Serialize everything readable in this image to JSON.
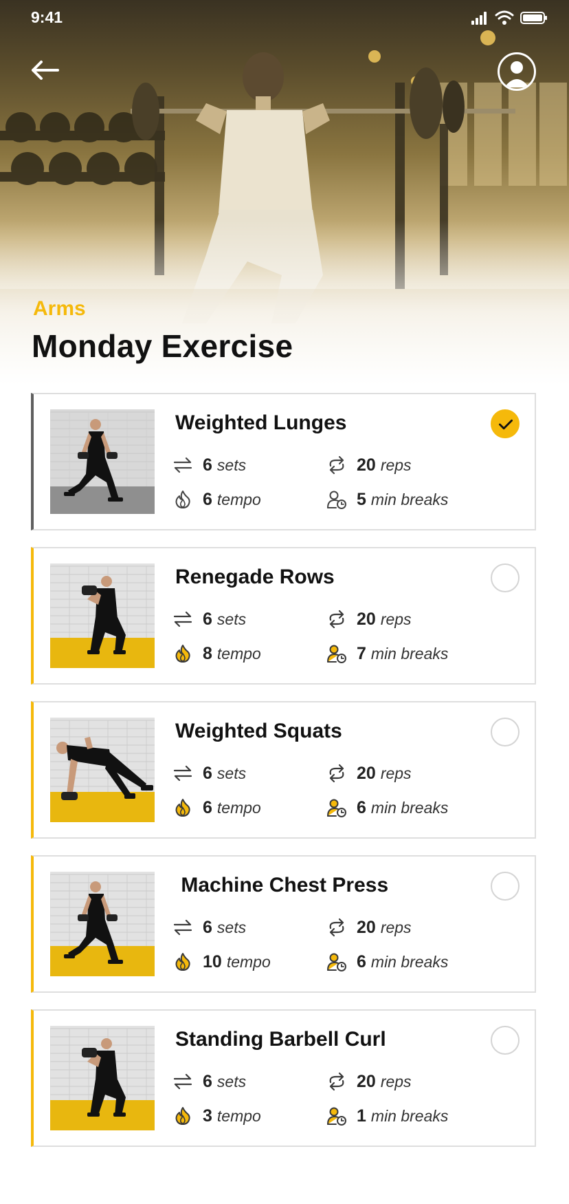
{
  "status_bar": {
    "time": "9:41"
  },
  "header": {
    "category": "Arms",
    "title": "Monday Exercise",
    "back_icon": "arrow-left-icon",
    "profile_icon": "avatar-icon"
  },
  "colors": {
    "accent": "#f5b90b",
    "done_bar": "#5f5f5f",
    "border": "#dedede"
  },
  "exercises": [
    {
      "name": "Weighted Lunges",
      "sets": "6",
      "sets_unit": "sets",
      "reps": "20",
      "reps_unit": "reps",
      "tempo": "6",
      "tempo_unit": "tempo",
      "breaks": "5",
      "breaks_unit": "min breaks",
      "completed": true,
      "photo": "lunge"
    },
    {
      "name": "Renegade Rows",
      "sets": "6",
      "sets_unit": "sets",
      "reps": "20",
      "reps_unit": "reps",
      "tempo": "8",
      "tempo_unit": "tempo",
      "breaks": "7",
      "breaks_unit": "min breaks",
      "completed": false,
      "photo": "squat"
    },
    {
      "name": "Weighted Squats",
      "sets": "6",
      "sets_unit": "sets",
      "reps": "20",
      "reps_unit": "reps",
      "tempo": "6",
      "tempo_unit": "tempo",
      "breaks": "6",
      "breaks_unit": "min breaks",
      "completed": false,
      "photo": "row"
    },
    {
      "name": " Machine Chest Press",
      "sets": "6",
      "sets_unit": "sets",
      "reps": "20",
      "reps_unit": "reps",
      "tempo": "10",
      "tempo_unit": "tempo",
      "breaks": "6",
      "breaks_unit": "min breaks",
      "completed": false,
      "photo": "lunge"
    },
    {
      "name": "Standing Barbell Curl",
      "sets": "6",
      "sets_unit": "sets",
      "reps": "20",
      "reps_unit": "reps",
      "tempo": "3",
      "tempo_unit": "tempo",
      "breaks": "1",
      "breaks_unit": "min breaks",
      "completed": false,
      "photo": "squat"
    }
  ],
  "stat_icons": {
    "sets": "transfer-arrows-icon",
    "reps": "repeat-icon",
    "tempo": "flame-icon",
    "breaks": "person-clock-icon"
  }
}
